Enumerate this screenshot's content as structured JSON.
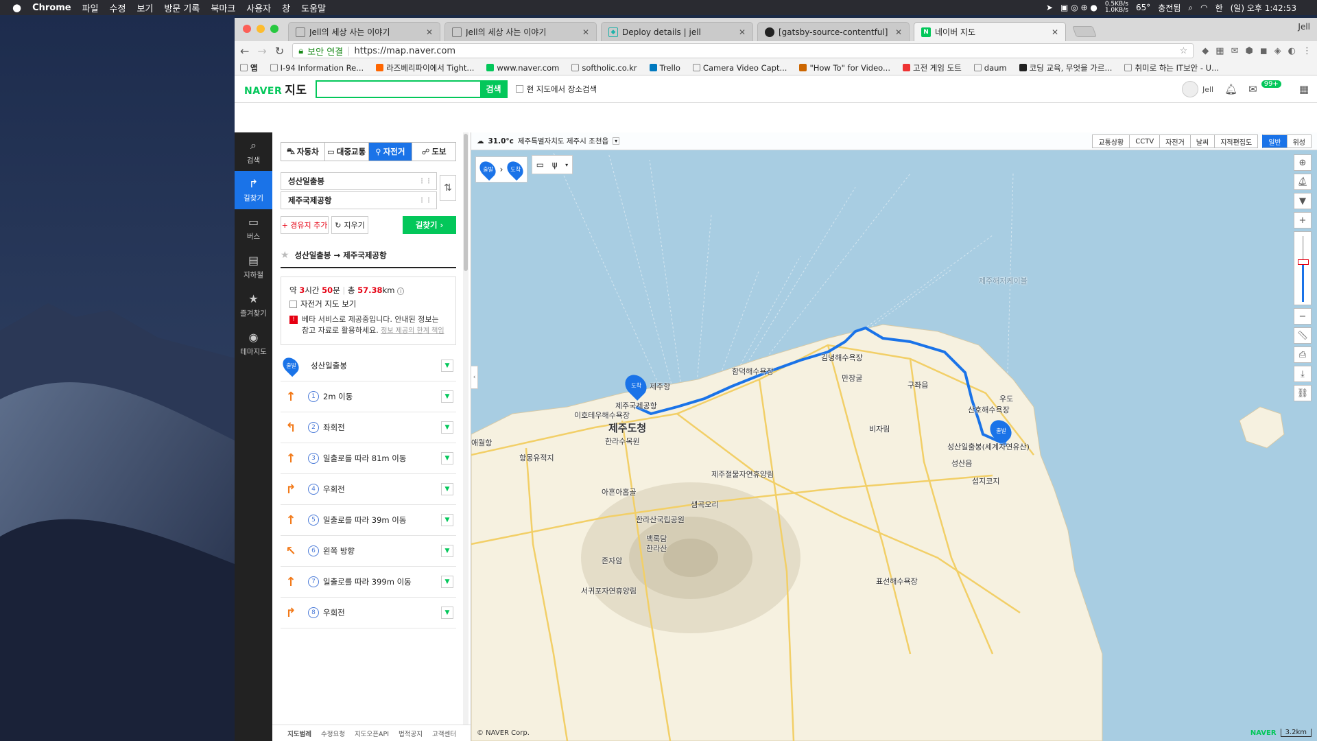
{
  "menubar": {
    "apple": "",
    "app": "Chrome",
    "items": [
      "파일",
      "수정",
      "보기",
      "방문 기록",
      "북마크",
      "사용자",
      "창",
      "도움말"
    ],
    "net": "0.5KB/s\n1.0KB/s",
    "temp": "65°",
    "battery": "충전됨",
    "lang": "한",
    "clock": "(일) 오후 1:42:53"
  },
  "browser": {
    "tabs": [
      {
        "title": "Jell의 세상 사는 이야기",
        "icon": "page-icon"
      },
      {
        "title": "Jell의 세상 사는 이야기",
        "icon": "page-icon"
      },
      {
        "title": "Deploy details | jell",
        "icon": "netlify-icon"
      },
      {
        "title": "[gatsby-source-contentful] Im",
        "icon": "github-icon"
      },
      {
        "title": "네이버 지도",
        "icon": "naver-icon",
        "active": true
      }
    ],
    "profile": "Jell",
    "secure": "보안 연결",
    "url": "https://map.naver.com",
    "bookmarks": [
      "앱",
      "I-94 Information Re...",
      "라즈베리파이에서 Tight...",
      "www.naver.com",
      "softholic.co.kr",
      "Trello",
      "Camera Video Capt...",
      "\"How To\" for Video...",
      "고전 게임 도트",
      "daum",
      "코딩 교육, 무엇을 가르...",
      "취미로 하는 IT보안 - U..."
    ]
  },
  "naver": {
    "logo": "NAVER",
    "logo_sub": "지도",
    "search_btn": "검색",
    "area_search": "현 지도에서 장소검색",
    "user": "Jell",
    "mail_badge": "99+",
    "nav": [
      {
        "label": "검색",
        "icon": "search-icon"
      },
      {
        "label": "길찾기",
        "icon": "directions-icon"
      },
      {
        "label": "버스",
        "icon": "bus-icon"
      },
      {
        "label": "지하철",
        "icon": "subway-icon"
      },
      {
        "label": "즐겨찾기",
        "icon": "star-icon"
      },
      {
        "label": "테마지도",
        "icon": "pin-icon"
      }
    ],
    "modes": [
      "자동차",
      "대중교통",
      "자전거",
      "도보"
    ],
    "from": "성산일출봉",
    "to": "제주국제공항",
    "add_waypoint": "+ 경유지 추가",
    "clear": "지우기",
    "find": "길찾기 ›",
    "route_title": "성산일출봉 → 제주국제공항",
    "summary": {
      "about": "약",
      "hours": "3",
      "hours_unit": "시간",
      "minutes": "50",
      "minutes_unit": "분",
      "total": "총",
      "distance": "57.38",
      "distance_unit": "km",
      "bike_map": "자전거 지도 보기",
      "notice": "베타 서비스로 제공중입니다. 안내된 정보는 참고 자료로 활용하세요.",
      "notice_link": "정보 제공의 한계 책임"
    },
    "start_badge": "출발",
    "start_label": "성산일출봉",
    "steps": [
      {
        "n": "1",
        "text": "2m 이동",
        "arrow": "↑"
      },
      {
        "n": "2",
        "text": "좌회전",
        "arrow": "↰"
      },
      {
        "n": "3",
        "text": "일출로를 따라 81m 이동",
        "arrow": "↑"
      },
      {
        "n": "4",
        "text": "우회전",
        "arrow": "↱"
      },
      {
        "n": "5",
        "text": "일출로를 따라 39m 이동",
        "arrow": "↑"
      },
      {
        "n": "6",
        "text": "왼쪽 방향",
        "arrow": "↖"
      },
      {
        "n": "7",
        "text": "일출로를 따라 399m 이동",
        "arrow": "↑"
      },
      {
        "n": "8",
        "text": "우회전",
        "arrow": "↱"
      }
    ],
    "footer": [
      "지도범례",
      "수정요청",
      "지도오픈API",
      "법적공지",
      "고객센터"
    ]
  },
  "map": {
    "weather": "31.0°c",
    "location": "제주특별자치도 제주시 조천읍",
    "tabs": [
      "교통상황",
      "CCTV",
      "자전거",
      "날씨",
      "지적편집도",
      "일반",
      "위성"
    ],
    "active_tab": "일반",
    "pin_start": "출발",
    "pin_end": "도착",
    "labels": [
      "제주항",
      "제주국제공항",
      "이호테우해수욕장",
      "제주도청",
      "한라수목원",
      "항몽유적지",
      "애월항",
      "제주절물자연휴양림",
      "아흔아홉골",
      "샘곡오리",
      "한라산국립공원",
      "백록담",
      "한라산",
      "존자암",
      "서귀포자연휴양림",
      "함덕해수욕장",
      "김녕해수욕장",
      "만장굴",
      "구좌읍",
      "비자림",
      "산호해수욕장",
      "우도",
      "성산일출봉(세계자연유산)",
      "성산읍",
      "섭지코지",
      "표선해수욕장",
      "제주해저케이블"
    ],
    "copyright": "© NAVER Corp.",
    "scale": "3.2km",
    "brand": "NAVER"
  }
}
